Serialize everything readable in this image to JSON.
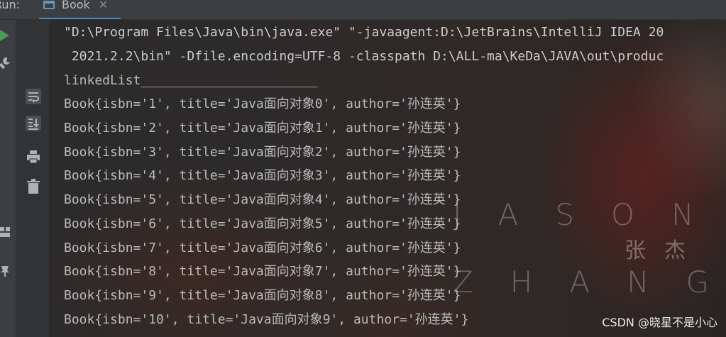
{
  "header": {
    "run_label": "Run:",
    "tab_label": "Book",
    "close_glyph": "✕"
  },
  "console": {
    "cmd_lines": [
      "\"D:\\Program Files\\Java\\bin\\java.exe\" \"-javaagent:D:\\JetBrains\\IntelliJ IDEA 20",
      " 2021.2.2\\bin\" -Dfile.encoding=UTF-8 -classpath D:\\ALL-ma\\KeDa\\JAVA\\out\\produc"
    ],
    "header_line": "linkedList_______________________",
    "books": [
      "Book{isbn='1', title='Java面向对象0', author='孙连英'}",
      "Book{isbn='2', title='Java面向对象1', author='孙连英'}",
      "Book{isbn='3', title='Java面向对象2', author='孙连英'}",
      "Book{isbn='4', title='Java面向对象3', author='孙连英'}",
      "Book{isbn='5', title='Java面向对象4', author='孙连英'}",
      "Book{isbn='6', title='Java面向对象5', author='孙连英'}",
      "Book{isbn='7', title='Java面向对象6', author='孙连英'}",
      "Book{isbn='8', title='Java面向对象7', author='孙连英'}",
      "Book{isbn='9', title='Java面向对象8', author='孙连英'}",
      "Book{isbn='10', title='Java面向对象9', author='孙连英'}"
    ]
  },
  "watermark": {
    "top_letters": "JASON",
    "chinese": "张杰",
    "bottom_letters": "ZHANG",
    "credit": "CSDN @晓星不是小心"
  },
  "icons": {
    "run": "play-icon",
    "build": "wrench-icon",
    "soft_wrap": "soft-wrap-icon",
    "scroll_end": "scroll-to-end-icon",
    "print": "print-icon",
    "delete": "trash-icon",
    "layout": "layout-icon",
    "pin": "pin-icon"
  },
  "colors": {
    "background": "#2b2b2b",
    "text": "#bbbbbb",
    "run_green": "#499c54",
    "accent": "#4a88c7"
  }
}
